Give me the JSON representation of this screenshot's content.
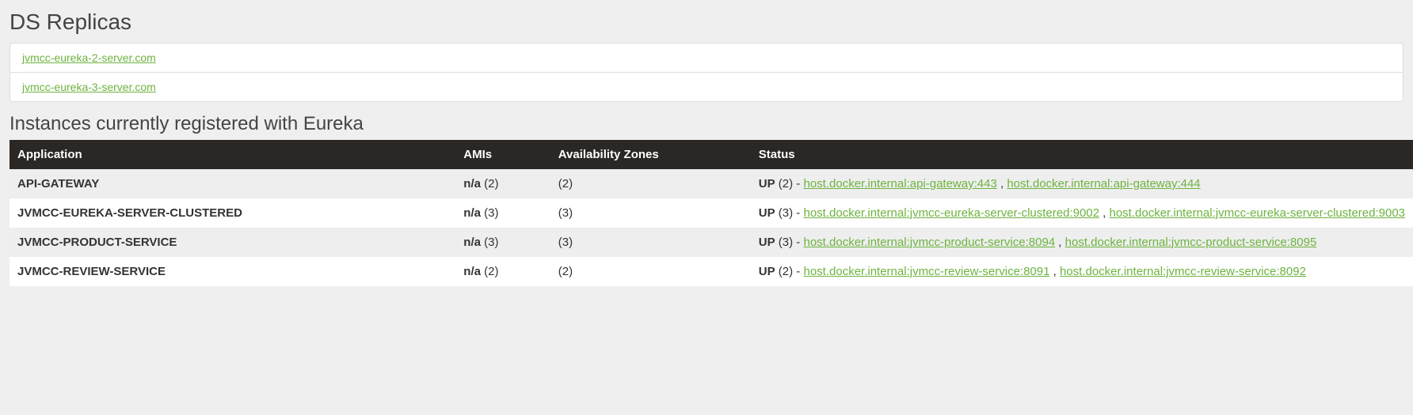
{
  "replicas": {
    "heading": "DS Replicas",
    "items": [
      "jvmcc-eureka-2-server.com",
      "jvmcc-eureka-3-server.com"
    ]
  },
  "instances": {
    "heading": "Instances currently registered with Eureka",
    "headers": {
      "application": "Application",
      "amis": "AMIs",
      "zones": "Availability Zones",
      "status": "Status"
    },
    "rows": [
      {
        "application": "API-GATEWAY",
        "amis_label": "n/a",
        "amis_count": "(2)",
        "zones_count": "(2)",
        "status_label": "UP",
        "status_count": "(2)",
        "links": [
          "host.docker.internal:api-gateway:443",
          "host.docker.internal:api-gateway:444"
        ]
      },
      {
        "application": "JVMCC-EUREKA-SERVER-CLUSTERED",
        "amis_label": "n/a",
        "amis_count": "(3)",
        "zones_count": "(3)",
        "status_label": "UP",
        "status_count": "(3)",
        "links": [
          "host.docker.internal:jvmcc-eureka-server-clustered:9002",
          "host.docker.internal:jvmcc-eureka-server-clustered:9003"
        ]
      },
      {
        "application": "JVMCC-PRODUCT-SERVICE",
        "amis_label": "n/a",
        "amis_count": "(3)",
        "zones_count": "(3)",
        "status_label": "UP",
        "status_count": "(3)",
        "links": [
          "host.docker.internal:jvmcc-product-service:8094",
          "host.docker.internal:jvmcc-product-service:8095"
        ]
      },
      {
        "application": "JVMCC-REVIEW-SERVICE",
        "amis_label": "n/a",
        "amis_count": "(2)",
        "zones_count": "(2)",
        "status_label": "UP",
        "status_count": "(2)",
        "links": [
          "host.docker.internal:jvmcc-review-service:8091",
          "host.docker.internal:jvmcc-review-service:8092"
        ]
      }
    ]
  }
}
